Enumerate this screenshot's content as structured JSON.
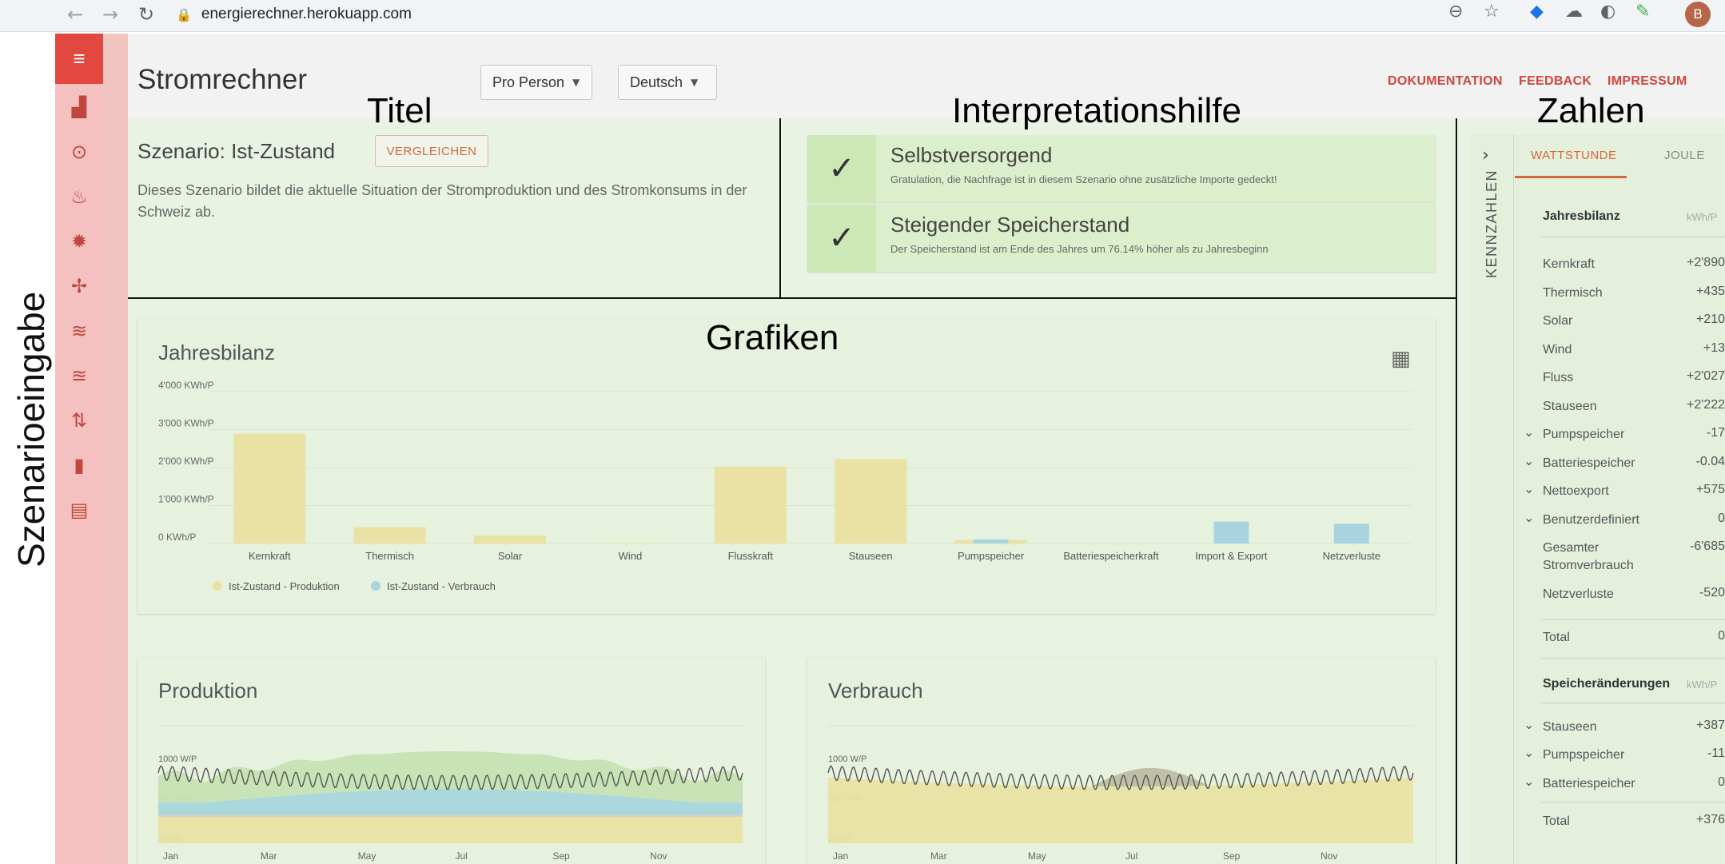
{
  "browser": {
    "url": "energierechner.herokuapp.com",
    "avatar": "B",
    "icons": [
      "back-arrow-icon",
      "forward-arrow-icon",
      "reload-icon",
      "lock-icon",
      "zoom-icon",
      "star-icon",
      "extension-icon"
    ]
  },
  "annotations": {
    "left": "Szenarioeingabe",
    "title": "Titel",
    "interpretation": "Interpretationshilfe",
    "numbers": "Zahlen",
    "charts": "Grafiken"
  },
  "sidebar": {
    "icons": [
      "menu-icon",
      "building-icon",
      "target-icon",
      "flame-icon",
      "sun-icon",
      "fan-icon",
      "water-waves-icon",
      "dam-icon",
      "pump-icon",
      "battery-icon",
      "add-note-icon"
    ]
  },
  "header": {
    "title": "Stromrechner",
    "person_select": "Pro Person",
    "language_select": "Deutsch",
    "links": [
      "DOKUMENTATION",
      "FEEDBACK",
      "IMPRESSUM"
    ]
  },
  "scenario": {
    "title": "Szenario: Ist-Zustand",
    "compare_button": "VERGLEICHEN",
    "description": "Dieses Szenario bildet die aktuelle Situation der Stromproduktion und des Stromkonsums in der Schweiz ab."
  },
  "interpretation": [
    {
      "title": "Selbstversorgend",
      "text": "Gratulation, die Nachfrage ist in diesem Szenario ohne zusätzliche Importe gedeckt!"
    },
    {
      "title": "Steigender Speicherstand",
      "text": "Der Speicherstand ist am Ende des Jahres um 76.14% höher als zu Jahresbeginn"
    }
  ],
  "jahresbilanz_card": {
    "title": "Jahresbilanz"
  },
  "produktion_card": {
    "title": "Produktion"
  },
  "verbrauch_card": {
    "title": "Verbrauch"
  },
  "chart_data": [
    {
      "type": "bar",
      "title": "Jahresbilanz",
      "categories": [
        "Kernkraft",
        "Thermisch",
        "Solar",
        "Wind",
        "Flusskraft",
        "Stauseen",
        "Pumpspeicher",
        "Batteriespeicherkraft",
        "Import & Export",
        "Netzverluste"
      ],
      "series": [
        {
          "name": "Ist-Zustand - Produktion",
          "color": "#e9e2a4",
          "values": [
            2890,
            435,
            210,
            13,
            2027,
            2222,
            90,
            0,
            0,
            0
          ]
        },
        {
          "name": "Ist-Zustand - Verbrauch",
          "color": "#a8d4e0",
          "values": [
            0,
            0,
            0,
            0,
            0,
            0,
            107,
            0,
            575,
            520
          ]
        }
      ],
      "yticks": [
        "0 KWh/P",
        "1'000 KWh/P",
        "2'000 KWh/P",
        "3'000 KWh/P",
        "4'000 KWh/P"
      ],
      "ylim": [
        0,
        4000
      ],
      "legend": "bottom-left"
    },
    {
      "type": "area",
      "title": "Produktion",
      "x": [
        "Jan",
        "Mar",
        "May",
        "Jul",
        "Sep",
        "Nov"
      ],
      "yticks": [
        "0 W/P",
        "500 W/P",
        "1000 W/P"
      ],
      "ylim": [
        0,
        1250
      ]
    },
    {
      "type": "area",
      "title": "Verbrauch",
      "x": [
        "Jan",
        "Mar",
        "May",
        "Jul",
        "Sep",
        "Nov"
      ],
      "yticks": [
        "0 W/P",
        "500 W/P",
        "1000 W/P"
      ],
      "ylim": [
        0,
        1250
      ]
    }
  ],
  "kennzahlen": {
    "toggle_label": "KENNZAHLEN",
    "tabs": [
      "WATTSTUNDE",
      "JOULE"
    ],
    "section1": {
      "title": "Jahresbilanz",
      "unit": "kWh/P"
    },
    "rows1": [
      {
        "label": "Kernkraft",
        "value": "+2'890",
        "expand": false
      },
      {
        "label": "Thermisch",
        "value": "+435",
        "expand": false
      },
      {
        "label": "Solar",
        "value": "+210",
        "expand": false
      },
      {
        "label": "Wind",
        "value": "+13",
        "expand": false
      },
      {
        "label": "Fluss",
        "value": "+2'027",
        "expand": false
      },
      {
        "label": "Stauseen",
        "value": "+2'222",
        "expand": false
      },
      {
        "label": "Pumpspeicher",
        "value": "-17",
        "expand": true
      },
      {
        "label": "Batteriespeicher",
        "value": "-0.04",
        "expand": true
      },
      {
        "label": "Nettoexport",
        "value": "+575",
        "expand": true
      },
      {
        "label": "Benutzerdefiniert",
        "value": "0",
        "expand": true
      },
      {
        "label": "Gesamter Stromverbrauch",
        "value": "-6'685",
        "expand": false
      },
      {
        "label": "Netzverluste",
        "value": "-520",
        "expand": false
      }
    ],
    "total1": {
      "label": "Total",
      "value": "0"
    },
    "section2": {
      "title": "Speicheränderungen",
      "unit": "kWh/P"
    },
    "rows2": [
      {
        "label": "Stauseen",
        "value": "+387",
        "expand": true
      },
      {
        "label": "Pumpspeicher",
        "value": "-11",
        "expand": true
      },
      {
        "label": "Batteriespeicher",
        "value": "0",
        "expand": true
      }
    ],
    "total2": {
      "label": "Total",
      "value": "+376"
    }
  }
}
